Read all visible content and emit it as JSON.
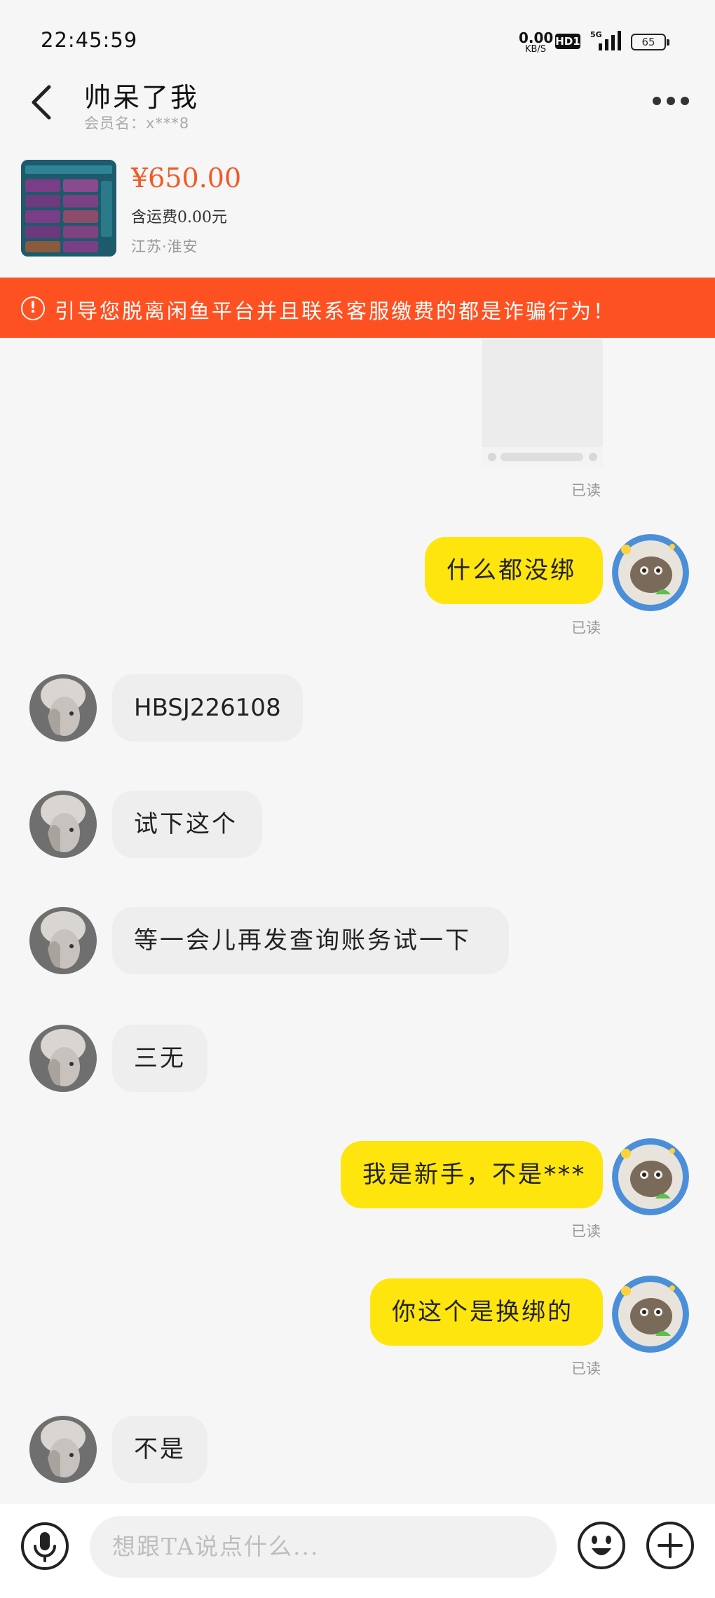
{
  "status_bar": {
    "time": "22:45:59",
    "net_speed": "0.00",
    "net_unit": "KB/S",
    "hd_badge": "HD1",
    "network": "5G",
    "battery": "65"
  },
  "header": {
    "title": "帅呆了我",
    "member": "会员名：x***8",
    "back_icon": "chevron-left-icon",
    "more_icon": "more-dots-icon"
  },
  "product": {
    "price": "¥650.00",
    "shipping": "含运费0.00元",
    "location": "江苏·淮安"
  },
  "warning": {
    "icon": "!",
    "text": "引导您脱离闲鱼平台并且联系客服缴费的都是诈骗行为！",
    "color": "#fe5122"
  },
  "messages": [
    {
      "side": "mine",
      "kind": "image",
      "status": "已读"
    },
    {
      "side": "mine",
      "text": "什么都没绑",
      "status": "已读"
    },
    {
      "side": "theirs",
      "text": "HBSJ226108"
    },
    {
      "side": "theirs",
      "text": "试下这个"
    },
    {
      "side": "theirs",
      "text": "等一会儿再发查询账务试一下"
    },
    {
      "side": "theirs",
      "text": "三无"
    },
    {
      "side": "mine",
      "text": "我是新手，不是***",
      "status": "已读"
    },
    {
      "side": "mine",
      "text": "你这个是换绑的",
      "status": "已读"
    },
    {
      "side": "theirs",
      "text": "不是"
    }
  ],
  "input_bar": {
    "placeholder": "想跟TA说点什么...",
    "mic_icon": "microphone-icon",
    "emoji_icon": "emoji-icon",
    "plus_icon": "plus-icon"
  },
  "colors": {
    "accent_price": "#f25a24",
    "my_bubble": "#ffe50e",
    "their_bubble": "#eeeeee"
  }
}
